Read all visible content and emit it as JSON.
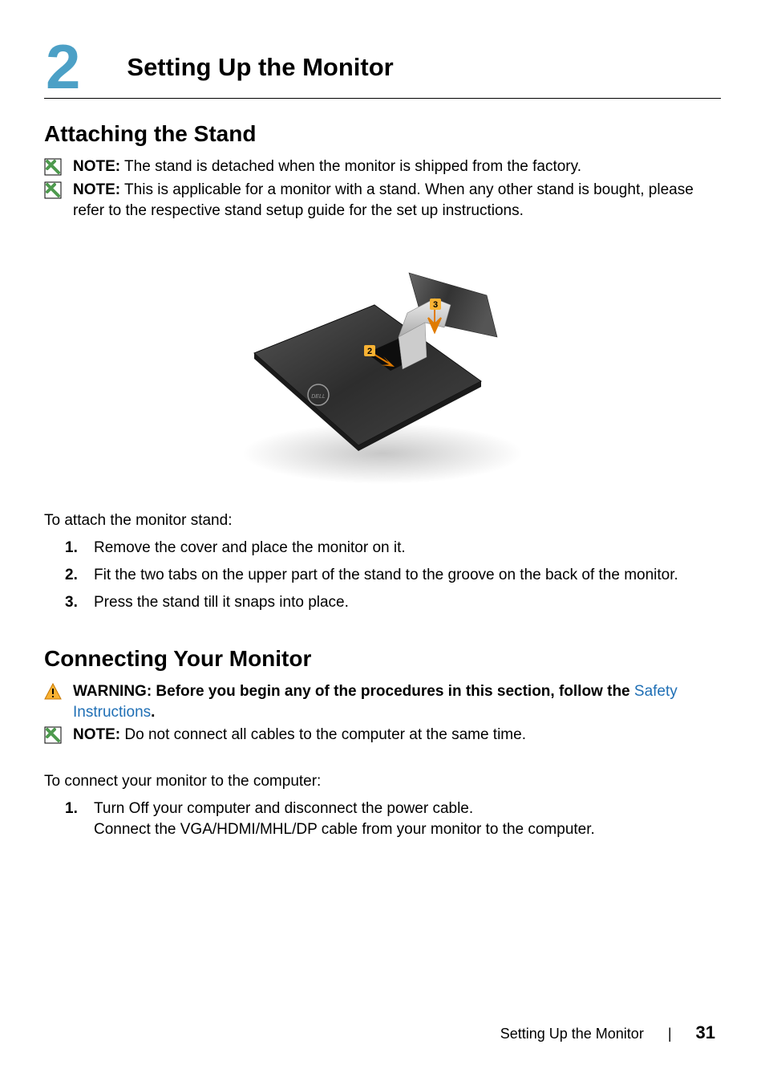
{
  "chapter": {
    "number": "2",
    "title": "Setting Up the Monitor"
  },
  "section1": {
    "title": "Attaching the Stand",
    "note1_b": "NOTE:",
    "note1_t": " The stand is detached when the monitor is shipped from the factory.",
    "note2_b": "NOTE:",
    "note2_t": " This is applicable for a monitor with a stand. When any other stand is bought, please refer to the respective stand setup guide for the set up instructions.",
    "intro": "To attach the monitor stand:",
    "step1_n": "1.",
    "step1_t": "Remove the cover and place the monitor on it.",
    "step2_n": "2.",
    "step2_t": "Fit the two tabs on the upper part of the stand to the groove on the back of the monitor.",
    "step3_n": "3.",
    "step3_t": "Press the stand till it snaps into place."
  },
  "section2": {
    "title": "Connecting Your Monitor",
    "warn_b": "WARNING:  Before you begin any of the procedures in this section, follow the ",
    "warn_link": "Safety Instructions",
    "warn_dot": ".",
    "note_b": "NOTE:",
    "note_t": " Do not connect all cables to the computer at the same time.",
    "intro": "To connect your monitor to the computer:",
    "step1_n": "1.",
    "step1_t": "Turn Off your computer and disconnect the power cable.\nConnect the VGA/HDMI/MHL/DP cable from your monitor to the computer."
  },
  "footer": {
    "section": "Setting Up the Monitor",
    "page": "31"
  },
  "diagram": {
    "callout2": "2",
    "callout3": "3"
  }
}
